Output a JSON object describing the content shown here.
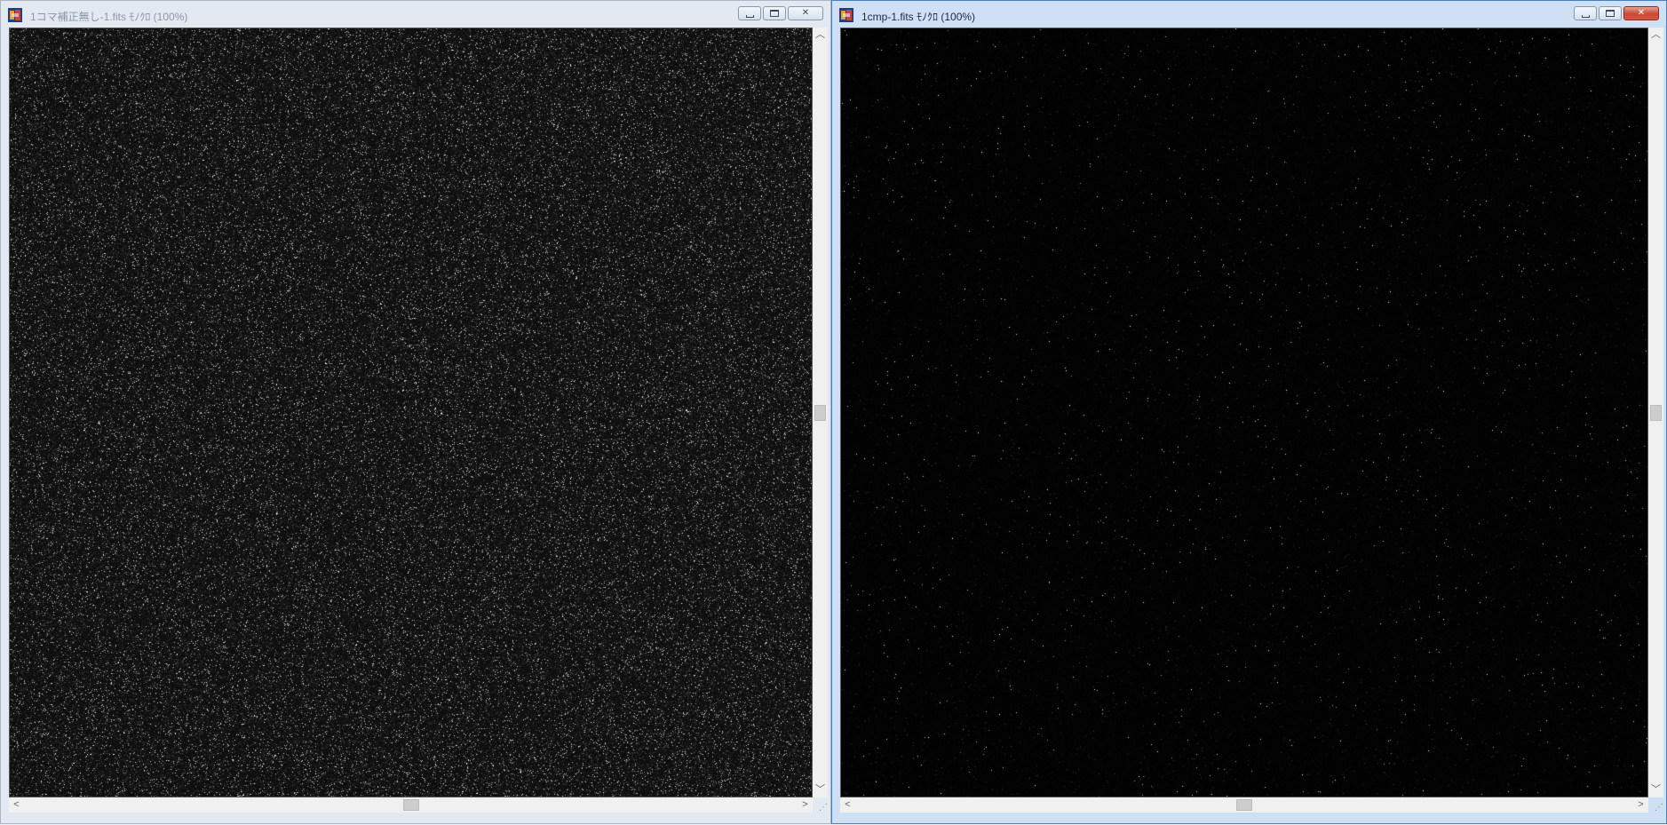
{
  "windows": [
    {
      "id": "left",
      "title": "1コマ補正無し-1.fits ﾓﾉｸﾛ (100%)",
      "active": false,
      "image": {
        "noise_density": "high",
        "description_icon": "fits-image-canvas"
      }
    },
    {
      "id": "right",
      "title": "1cmp-1.fits ﾓﾉｸﾛ (100%)",
      "active": true,
      "image": {
        "noise_density": "low",
        "description_icon": "fits-image-canvas"
      }
    }
  ],
  "caption_buttons": {
    "minimize_icon": "minimize-icon",
    "maximize_icon": "maximize-icon",
    "close_icon": "close-icon",
    "close_glyph": "✕"
  },
  "scrollbar": {
    "up_glyph": "︿",
    "down_glyph": "﹀",
    "left_glyph": "<",
    "right_glyph": ">",
    "grip_glyph": "⋰"
  },
  "colors": {
    "active_border": "#4a7fbf",
    "inactive_title": "#8a96a6",
    "close_red": "#c84a34"
  }
}
